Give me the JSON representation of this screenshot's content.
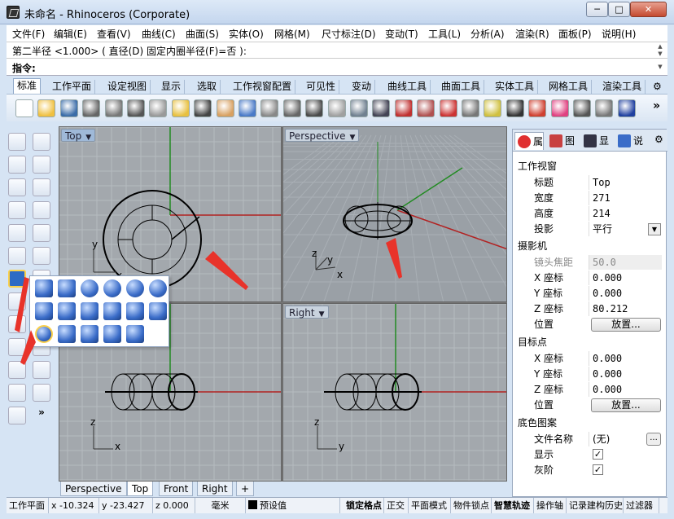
{
  "window": {
    "title": "未命名 - Rhinoceros (Corporate)",
    "min": "─",
    "max": "□",
    "close": "✕"
  },
  "menu": [
    "文件(F)",
    "编辑(E)",
    "查看(V)",
    "曲线(C)",
    "曲面(S)",
    "实体(O)",
    "网格(M)",
    "尺寸标注(D)",
    "变动(T)",
    "工具(L)",
    "分析(A)",
    "渲染(R)",
    "面板(P)",
    "说明(H)"
  ],
  "command": {
    "history": "第二半径 <1.000> ( 直径(D)  固定内圈半径(F)=否 ):",
    "prompt": "指令:"
  },
  "toolbar_tabs": [
    "标准",
    "工作平面",
    "设定视图",
    "显示",
    "选取",
    "工作视窗配置",
    "可见性",
    "变动",
    "曲线工具",
    "曲面工具",
    "实体工具",
    "网格工具",
    "渲染工具"
  ],
  "toolbar_more": "»",
  "toolbar_icons": [
    "new-file-icon",
    "open-file-icon",
    "save-icon",
    "print-icon",
    "import-icon",
    "cut-icon",
    "copy-icon",
    "paste-icon",
    "undo-icon",
    "pan-hand-icon",
    "rotate-view-icon",
    "zoom-icon",
    "zoom-window-icon",
    "zoom-extents-icon",
    "zoom-selected-icon",
    "undo-view-icon",
    "four-viewports-icon",
    "car-icon",
    "point-cloud-icon",
    "gumball-icon",
    "osnap-icon",
    "light-bulb-icon",
    "lock-icon",
    "material-icon",
    "color-wheel-icon",
    "render-sphere-icon",
    "render-preview-icon",
    "shaded-sphere-icon"
  ],
  "viewports": {
    "top": {
      "label": "Top",
      "axis_x": "x",
      "axis_y": "y"
    },
    "perspective": {
      "label": "Perspective",
      "axis_x": "x",
      "axis_y": "y",
      "axis_z": "z"
    },
    "front": {
      "label": "Front",
      "axis_x": "x",
      "axis_z": "z"
    },
    "right": {
      "label": "Right",
      "axis_y": "y",
      "axis_z": "z"
    }
  },
  "viewport_tabs": [
    "Perspective",
    "Top",
    "Front",
    "Right"
  ],
  "viewport_tab_add": "+",
  "sidebar_more": "»",
  "status": {
    "cplane": "工作平面",
    "x": "x -10.324",
    "y": "y -23.427",
    "z": "z 0.000",
    "unit": "毫米",
    "layer": "预设值",
    "snap": "锁定格点",
    "ortho": "正交",
    "planar": "平面模式",
    "osnap": "物件锁点",
    "smarttrack": "智慧轨迹",
    "gumball": "操作轴",
    "history": "记录建构历史",
    "filter": "过滤器"
  },
  "panel": {
    "tabs": [
      "属",
      "图",
      "显",
      "说"
    ],
    "section_viewport": "工作视窗",
    "title_label": "标题",
    "title_value": "Top",
    "width_label": "宽度",
    "width_value": "271",
    "height_label": "高度",
    "height_value": "214",
    "projection_label": "投影",
    "projection_value": "平行",
    "section_camera": "摄影机",
    "lens_label": "镜头焦距",
    "lens_value": "50.0",
    "cx_label": "X 座标",
    "cx_value": "0.000",
    "cy_label": "Y 座标",
    "cy_value": "0.000",
    "cz_label": "Z 座标",
    "cz_value": "80.212",
    "pos_label": "位置",
    "place_button": "放置...",
    "section_target": "目标点",
    "tx_label": "X 座标",
    "tx_value": "0.000",
    "ty_label": "Y 座标",
    "ty_value": "0.000",
    "tz_label": "Z 座标",
    "tz_value": "0.000",
    "tpos_label": "位置",
    "tplace_button": "放置...",
    "section_bg": "底色图案",
    "file_label": "文件名称",
    "file_value": "(无)",
    "browse": "...",
    "show_label": "显示",
    "show_check": "✓",
    "gray_label": "灰阶",
    "gray_check": "✓"
  },
  "colors": {
    "accent": "#3a7ac8",
    "grid_bg": "#a3a8ad",
    "x_axis": "#b22222",
    "y_axis": "#228b22"
  }
}
